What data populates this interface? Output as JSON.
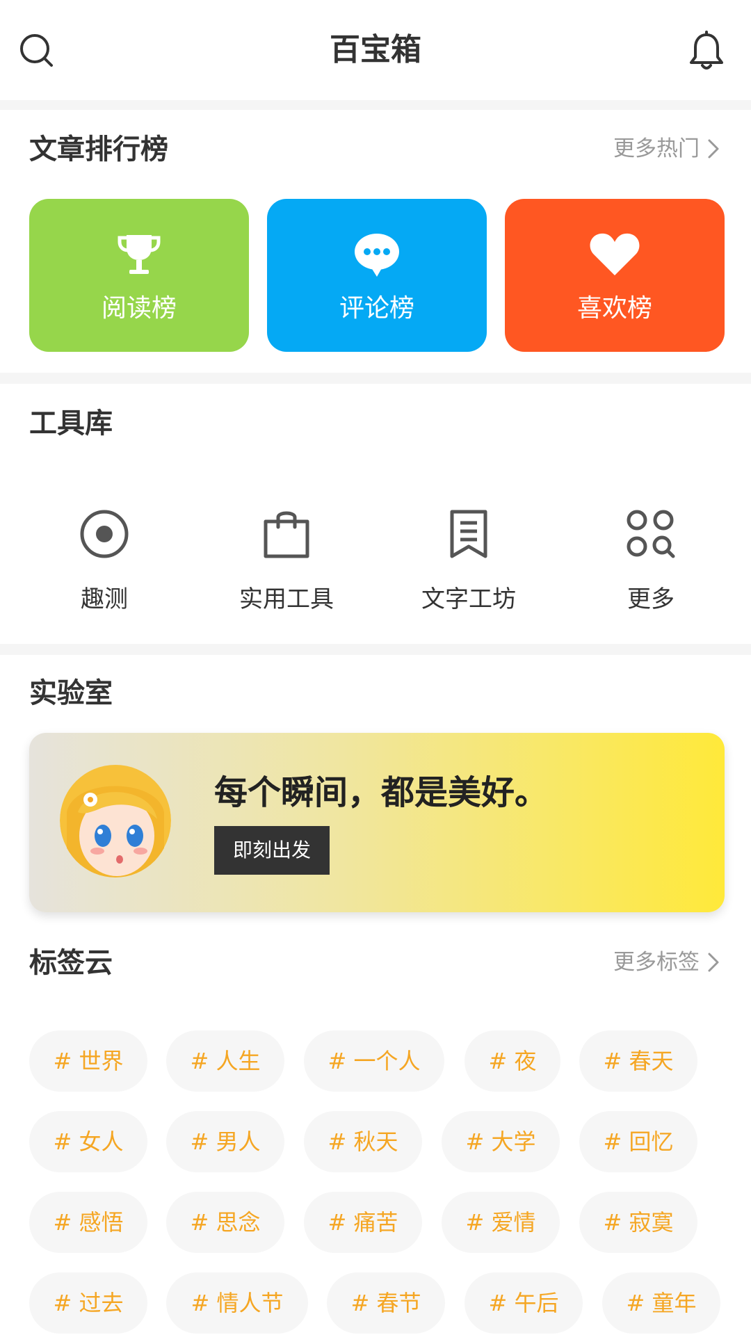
{
  "header": {
    "title": "百宝箱",
    "search_icon": "search-icon",
    "bell_icon": "bell-icon"
  },
  "ranking": {
    "title": "文章排行榜",
    "more_label": "更多热门",
    "cards": [
      {
        "label": "阅读榜",
        "icon": "trophy-icon",
        "color": "#96d64b"
      },
      {
        "label": "评论榜",
        "icon": "chat-bubble-icon",
        "color": "#05a9f4"
      },
      {
        "label": "喜欢榜",
        "icon": "heart-icon",
        "color": "#ff5722"
      }
    ]
  },
  "tools": {
    "title": "工具库",
    "items": [
      {
        "label": "趣测",
        "icon": "radio-target-icon"
      },
      {
        "label": "实用工具",
        "icon": "shopping-bag-icon"
      },
      {
        "label": "文字工坊",
        "icon": "document-bookmark-icon"
      },
      {
        "label": "更多",
        "icon": "grid-more-icon"
      }
    ]
  },
  "lab": {
    "title": "实验室",
    "banner_text": "每个瞬间，都是美好。",
    "button_label": "即刻出发",
    "avatar_icon": "anime-girl-avatar"
  },
  "tags": {
    "title": "标签云",
    "more_label": "更多标签",
    "items": [
      "# 世界",
      "# 人生",
      "# 一个人",
      "# 夜",
      "# 春天",
      "# 女人",
      "# 男人",
      "# 秋天",
      "# 大学",
      "# 回忆",
      "# 感悟",
      "# 思念",
      "# 痛苦",
      "# 爱情",
      "# 寂寞",
      "# 过去",
      "# 情人节",
      "# 春节",
      "# 午后",
      "# 童年"
    ]
  }
}
